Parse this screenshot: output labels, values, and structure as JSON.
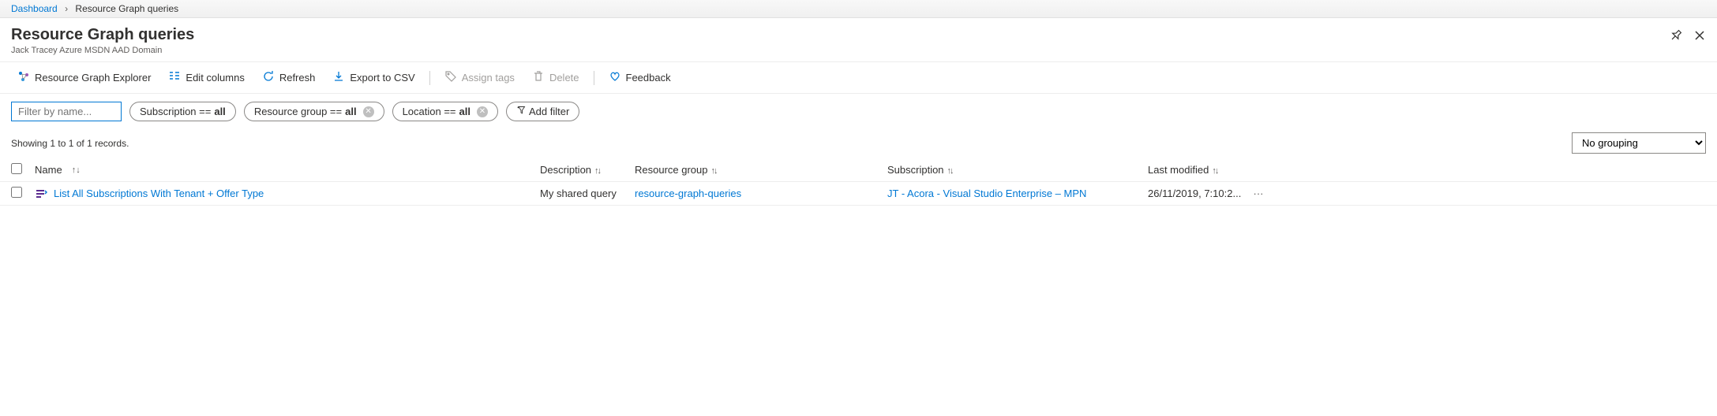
{
  "breadcrumb": {
    "root": "Dashboard",
    "current": "Resource Graph queries"
  },
  "header": {
    "title": "Resource Graph queries",
    "subtitle": "Jack Tracey Azure MSDN AAD Domain"
  },
  "toolbar": {
    "explorer": "Resource Graph Explorer",
    "edit_columns": "Edit columns",
    "refresh": "Refresh",
    "export_csv": "Export to CSV",
    "assign_tags": "Assign tags",
    "delete": "Delete",
    "feedback": "Feedback"
  },
  "filters": {
    "placeholder": "Filter by name...",
    "subscription": {
      "label": "Subscription == ",
      "value": "all"
    },
    "resource_group": {
      "label": "Resource group == ",
      "value": "all"
    },
    "location": {
      "label": "Location == ",
      "value": "all"
    },
    "add_filter": "Add filter"
  },
  "records": {
    "showing_text": "Showing 1 to 1 of 1 records.",
    "grouping_value": "No grouping"
  },
  "columns": {
    "name": "Name",
    "description": "Description",
    "resource_group": "Resource group",
    "subscription": "Subscription",
    "last_modified": "Last modified"
  },
  "rows": [
    {
      "name": "List All Subscriptions With Tenant + Offer Type",
      "description": "My shared query",
      "resource_group": "resource-graph-queries",
      "subscription": "JT - Acora - Visual Studio Enterprise – MPN",
      "last_modified": "26/11/2019, 7:10:2..."
    }
  ]
}
